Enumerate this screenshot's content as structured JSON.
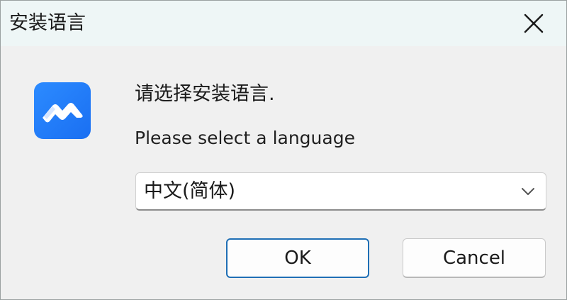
{
  "window": {
    "title": "安装语言"
  },
  "dialog": {
    "prompt_cn": "请选择安装语言.",
    "prompt_en": "Please select a language",
    "language_select": {
      "selected": "中文(简体)"
    },
    "ok_label": "OK",
    "cancel_label": "Cancel"
  },
  "icons": {
    "app": "app-logo-icon",
    "close": "close-icon",
    "dropdown": "chevron-down-icon"
  },
  "colors": {
    "titlebar_bg": "#eef6f6",
    "body_bg": "#f0f0f0",
    "accent_border": "#1f6fb5",
    "app_icon_blue": "#1a6ff2"
  }
}
